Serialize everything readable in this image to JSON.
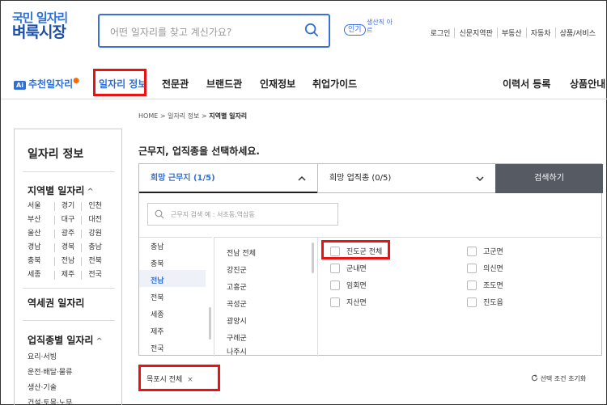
{
  "header": {
    "logo_line1": "국민 일자리",
    "logo_line2": "벼룩시장",
    "search_placeholder": "어떤 일자리를 찾고 계신가요?",
    "popular_label": "인기",
    "popular_roll": "생산직 아르",
    "util_links": [
      "로그인",
      "신문지역판",
      "부동산",
      "자동차",
      "상품/서비스"
    ]
  },
  "gnb": {
    "ai_badge": "Ai",
    "recommend": "추천일자리",
    "items": [
      "일자리 정보",
      "전문관",
      "브랜드관",
      "인재정보",
      "취업가이드"
    ],
    "right_items": [
      "이력서 등록",
      "상품안내"
    ]
  },
  "sidebar": {
    "title": "일자리 정보",
    "region_heading": "지역별 일자리",
    "region_rows": [
      [
        "서울",
        "경기",
        "인천"
      ],
      [
        "부산",
        "대구",
        "대전"
      ],
      [
        "울산",
        "광주",
        "강원"
      ],
      [
        "경남",
        "경북",
        "충남"
      ],
      [
        "충북",
        "전남",
        "전북"
      ],
      [
        "세종",
        "제주",
        "전국"
      ]
    ],
    "station_heading": "역세권 일자리",
    "job_heading": "업직종별 일자리",
    "job_items": [
      "요리·서빙",
      "운전·배달·물류",
      "생산·기술",
      "건설·토목·노무"
    ],
    "chevron": "^"
  },
  "main": {
    "breadcrumb": [
      "HOME",
      "일자리 정보",
      "지역별 일자리"
    ],
    "prompt": "근무지, 업직종을 선택하세요.",
    "tab_location": "희망 근무지 (1/5)",
    "tab_job": "희망 업직종 (0/5)",
    "search_button": "검색하기",
    "location_search_placeholder": "근무지 검색 예 : 서초동,역삼동",
    "provinces": [
      "충남",
      "충북",
      "전남",
      "전북",
      "세종",
      "제주",
      "전국"
    ],
    "selected_province": "전남",
    "cities": [
      "전남 전체",
      "강진군",
      "고흥군",
      "곡성군",
      "광양시",
      "구례군",
      "나주시"
    ],
    "districts_left": [
      "진도군 전체",
      "군내면",
      "임회면",
      "지산면"
    ],
    "districts_right": [
      "고군면",
      "의신면",
      "조도면",
      "진도읍"
    ],
    "selected_tag": "목포시 전체",
    "tag_close": "×",
    "reset_label": "선택 조건 초기화",
    "reset_icon": "refresh-icon"
  },
  "colors": {
    "brand": "#2f6fd6",
    "highlight": "#e11111",
    "button_bg": "#555a63"
  }
}
